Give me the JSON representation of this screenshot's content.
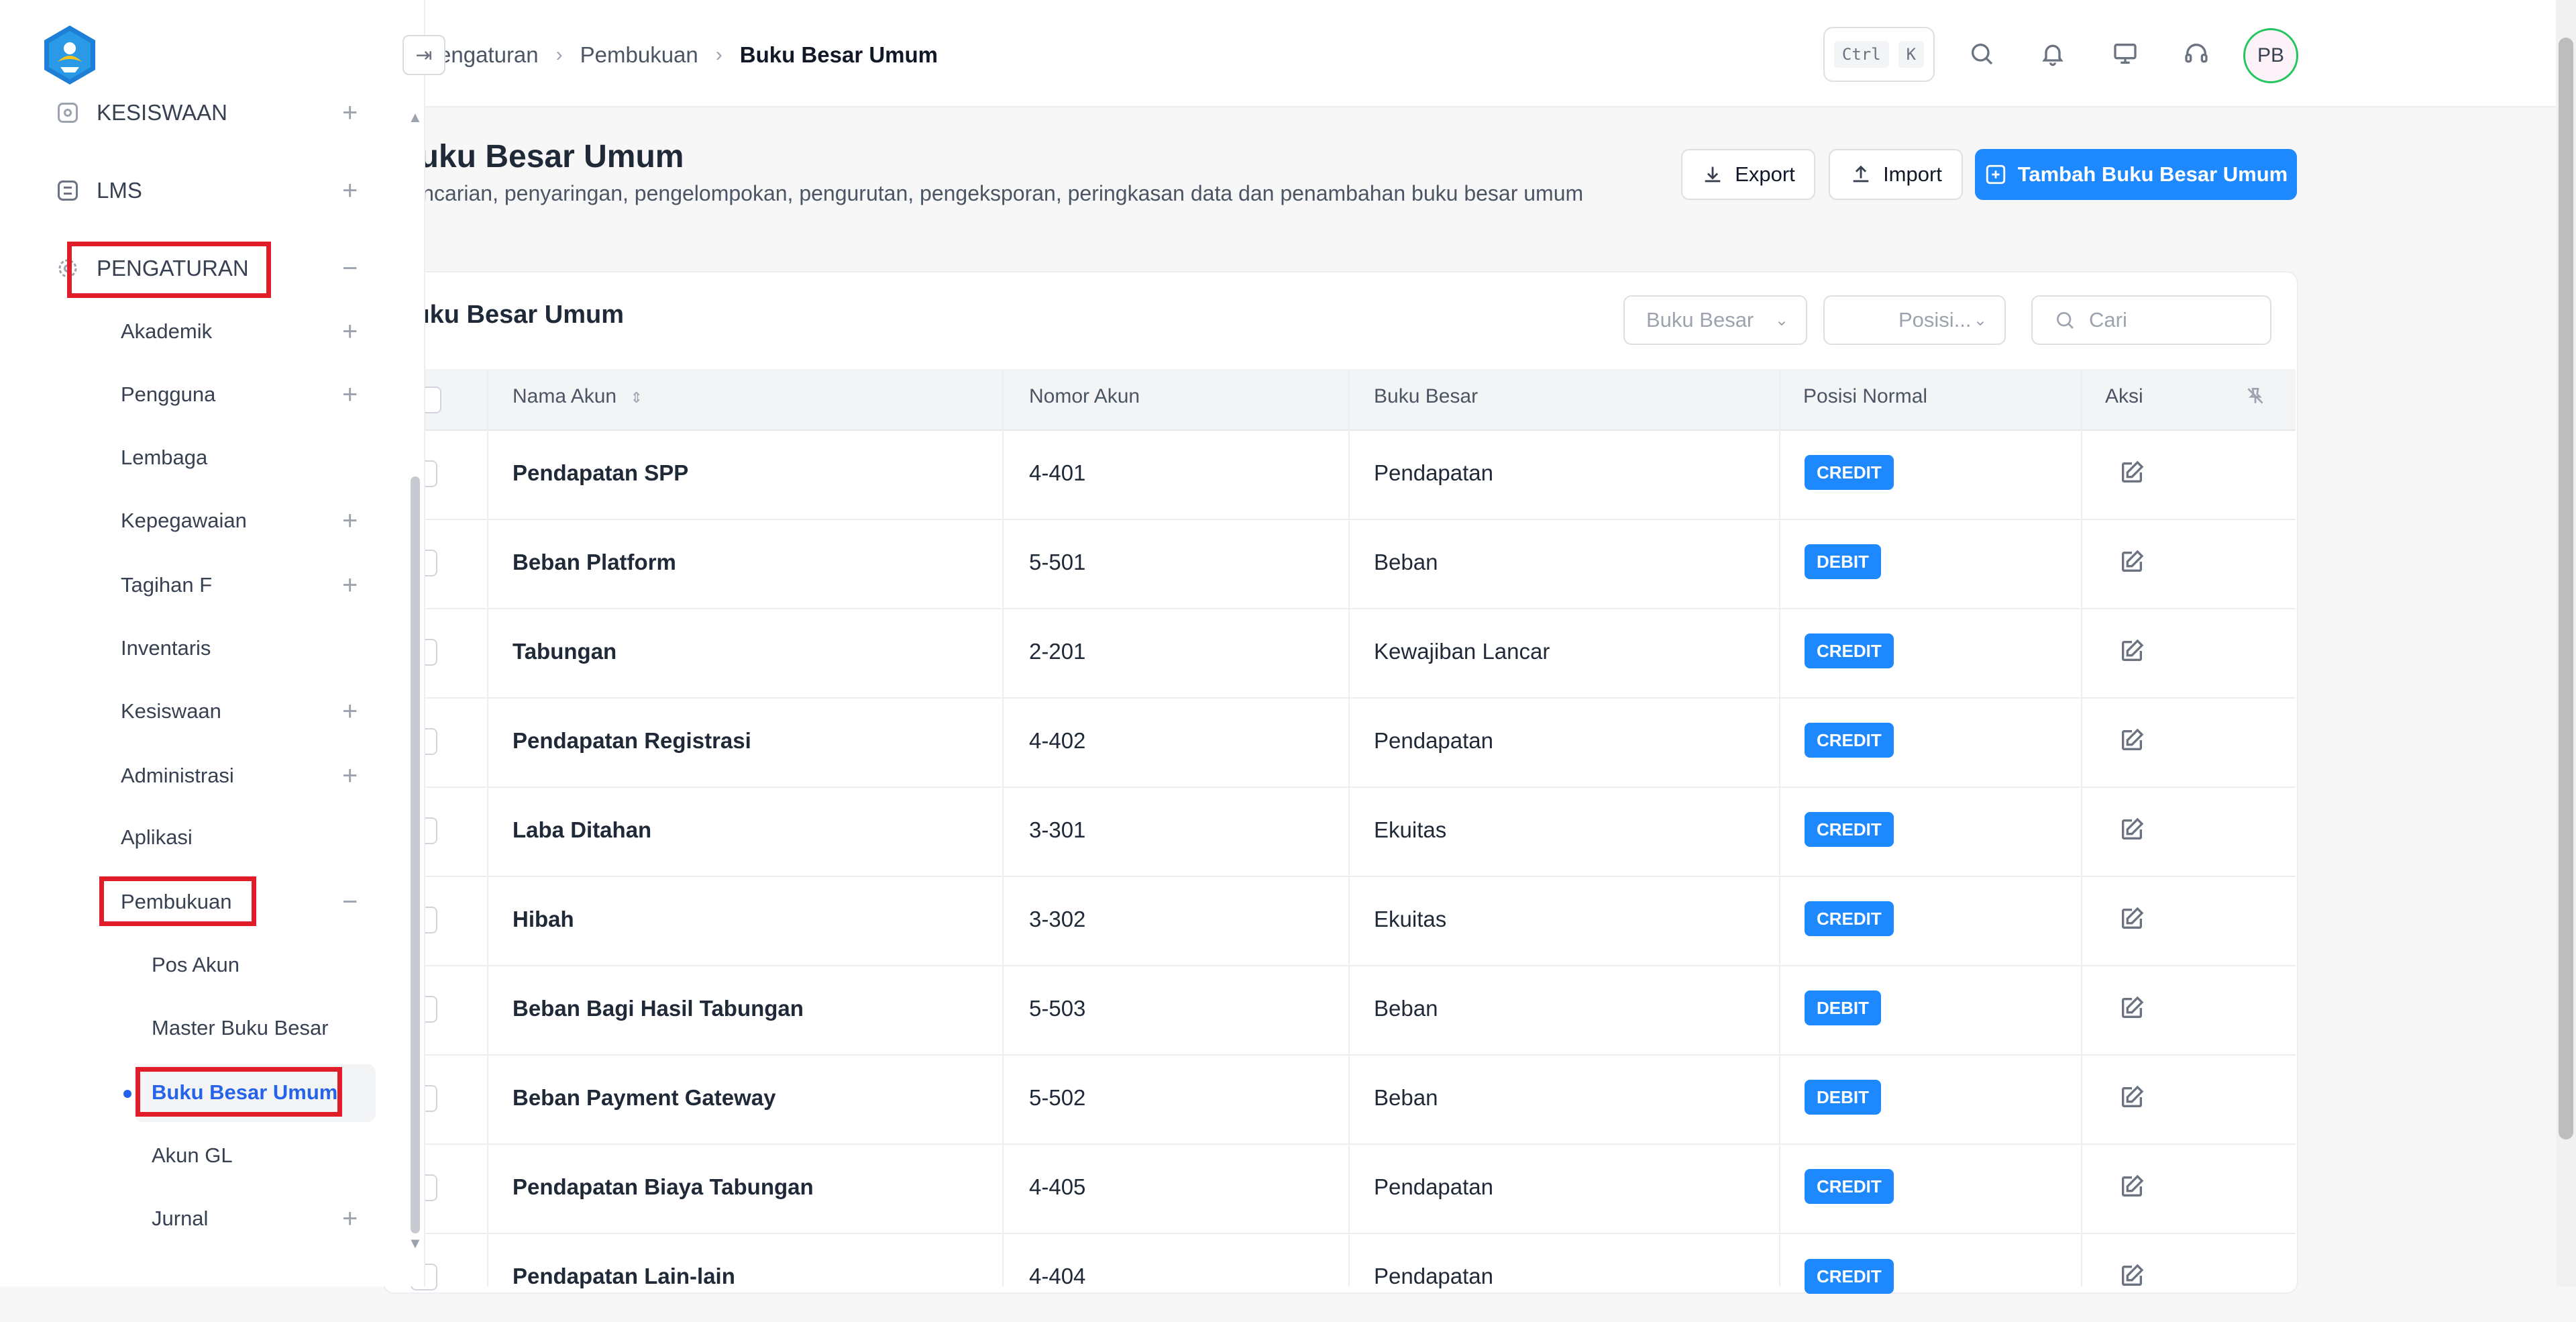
{
  "header": {
    "breadcrumbs": [
      "Pengaturan",
      "Pembukuan",
      "Buku Besar Umum"
    ],
    "collapse_glyph": "⇥",
    "shortcut_keys": [
      "Ctrl",
      "K"
    ],
    "icons": [
      "search-icon",
      "bell-icon",
      "monitor-icon",
      "headset-icon"
    ],
    "avatar_initials": "PB"
  },
  "sidebar": {
    "top_items": [
      {
        "label": "KESISWAAN",
        "icon": "gear-circle-icon",
        "expand": "+"
      },
      {
        "label": "LMS",
        "icon": "list-icon",
        "expand": "+"
      },
      {
        "label": "PENGATURAN",
        "icon": "gear-icon",
        "expand": "−"
      }
    ],
    "sub_items": [
      {
        "label": "Akademik",
        "expand": "+"
      },
      {
        "label": "Pengguna",
        "expand": "+"
      },
      {
        "label": "Lembaga",
        "expand": ""
      },
      {
        "label": "Kepegawaian",
        "expand": "+"
      },
      {
        "label": "Tagihan F",
        "expand": "+"
      },
      {
        "label": "Inventaris",
        "expand": ""
      },
      {
        "label": "Kesiswaan",
        "expand": "+"
      },
      {
        "label": "Administrasi",
        "expand": "+"
      },
      {
        "label": "Aplikasi",
        "expand": ""
      },
      {
        "label": "Pembukuan",
        "expand": "−"
      }
    ],
    "pembukuan_items": [
      {
        "label": "Pos Akun",
        "expand": ""
      },
      {
        "label": "Master Buku Besar",
        "expand": ""
      },
      {
        "label": "Buku Besar Umum",
        "expand": "",
        "active": true
      },
      {
        "label": "Akun GL",
        "expand": ""
      },
      {
        "label": "Jurnal",
        "expand": "+"
      }
    ],
    "accent_color": "#2563eb"
  },
  "page": {
    "title": "Buku Besar Umum",
    "subtitle": "Pencarian, penyaringan, pengelompokan, pengurutan, pengeksporan, peringkasan data dan penambahan buku besar umum",
    "buttons": {
      "export": "Export",
      "import": "Import",
      "add": "Tambah Buku Besar Umum"
    },
    "primary_color": "#1e88ff"
  },
  "table": {
    "title": "Buku Besar Umum",
    "filters": {
      "buku_besar": "Buku Besar",
      "posisi": "Posisi...",
      "search_placeholder": "Cari"
    },
    "columns": [
      "Nama Akun",
      "Nomor Akun",
      "Buku Besar",
      "Posisi Normal",
      "Aksi"
    ],
    "rows": [
      {
        "nama": "Pendapatan SPP",
        "nomor": "4-401",
        "buku": "Pendapatan",
        "posisi": "CREDIT"
      },
      {
        "nama": "Beban Platform",
        "nomor": "5-501",
        "buku": "Beban",
        "posisi": "DEBIT"
      },
      {
        "nama": "Tabungan",
        "nomor": "2-201",
        "buku": "Kewajiban Lancar",
        "posisi": "CREDIT"
      },
      {
        "nama": "Pendapatan Registrasi",
        "nomor": "4-402",
        "buku": "Pendapatan",
        "posisi": "CREDIT"
      },
      {
        "nama": "Laba Ditahan",
        "nomor": "3-301",
        "buku": "Ekuitas",
        "posisi": "CREDIT"
      },
      {
        "nama": "Hibah",
        "nomor": "3-302",
        "buku": "Ekuitas",
        "posisi": "CREDIT"
      },
      {
        "nama": "Beban Bagi Hasil Tabungan",
        "nomor": "5-503",
        "buku": "Beban",
        "posisi": "DEBIT"
      },
      {
        "nama": "Beban Payment Gateway",
        "nomor": "5-502",
        "buku": "Beban",
        "posisi": "DEBIT"
      },
      {
        "nama": "Pendapatan Biaya Tabungan",
        "nomor": "4-405",
        "buku": "Pendapatan",
        "posisi": "CREDIT"
      },
      {
        "nama": "Pendapatan Lain-lain",
        "nomor": "4-404",
        "buku": "Pendapatan",
        "posisi": "CREDIT"
      }
    ]
  }
}
